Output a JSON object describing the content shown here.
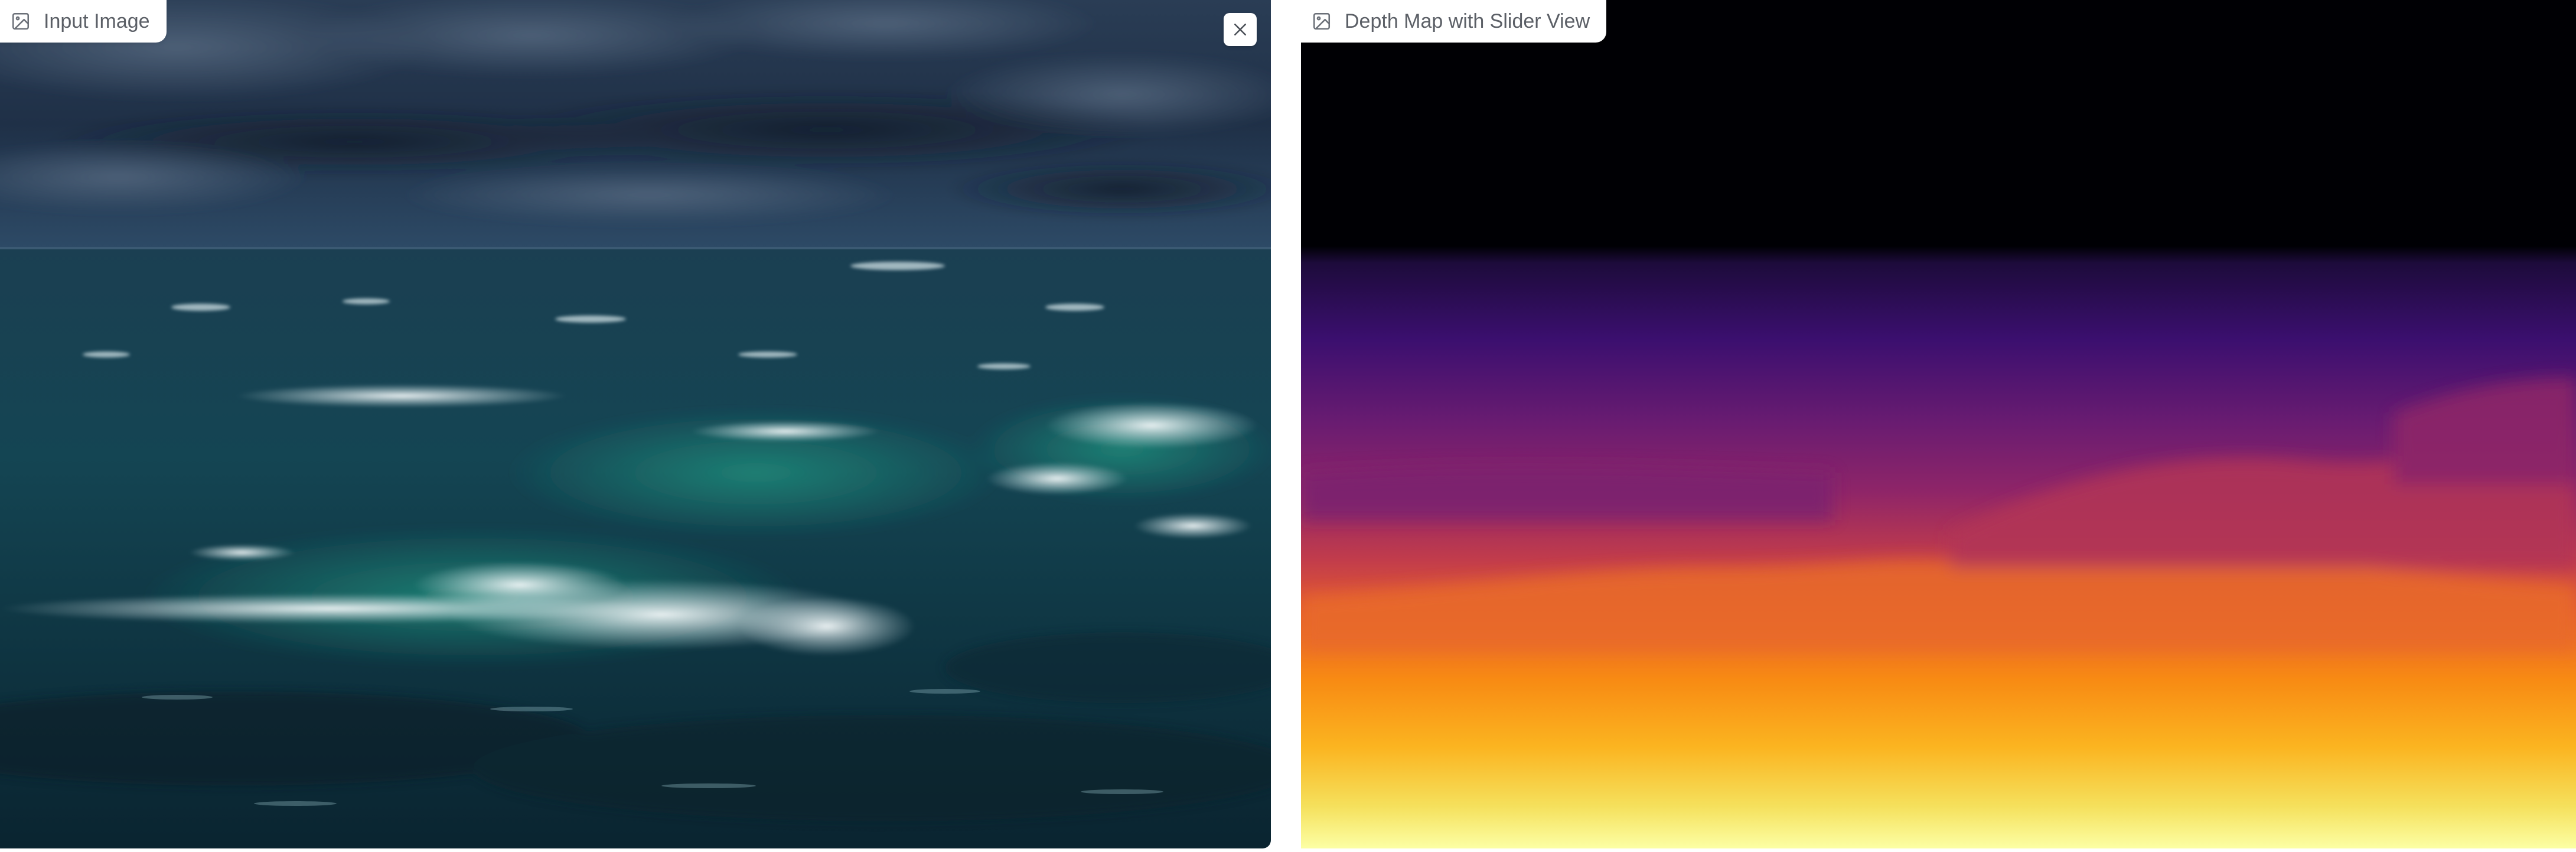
{
  "input_panel": {
    "label": "Input Image",
    "label_icon": "image-icon",
    "close_icon": "close-icon",
    "image_subject": "stormy sea with breaking waves under dark clouds"
  },
  "depth_panel": {
    "label": "Depth Map with Slider View",
    "label_icon": "image-icon",
    "image_subject": "inferno colormap depth map of the seascape"
  },
  "colors": {
    "sky_dark": "#1b2a3d",
    "sea_dark": "#0f2e3b",
    "foam": "#e8f0f2",
    "depth_far": "#000004",
    "depth_mid": "#7a1f6f",
    "depth_near": "#fcffa4"
  }
}
